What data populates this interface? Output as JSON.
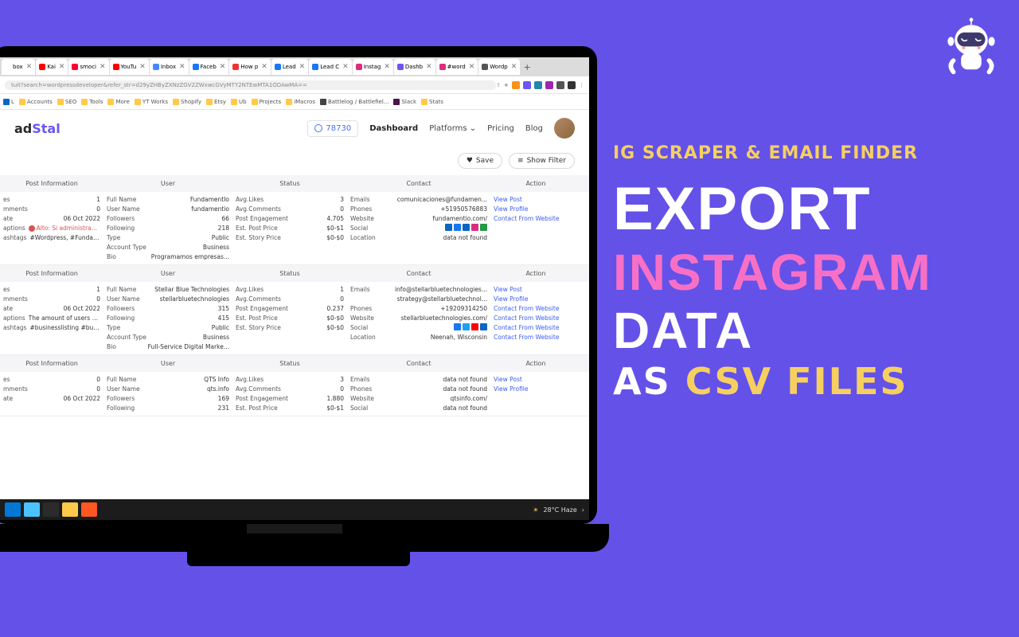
{
  "headline": {
    "sub": "IG SCRAPER & EMAIL FINDER",
    "l1": "EXPORT",
    "l2": "INSTAGRAM",
    "l3": "DATA",
    "l4a": "AS ",
    "l4b": "CSV FILES"
  },
  "tabs": [
    "box",
    "Kai",
    "smoci",
    "YouTu",
    "Inbox",
    "Faceb",
    "How p",
    "Lead",
    "Lead C",
    "Instag",
    "Dashb",
    "#word",
    "Wordp"
  ],
  "address": "tuit?search=wordpressdeveloper&refer_str=d29yZHByZXNzZGV2ZWxwcGVyMTY2NTEwMTA1ODAwMA==",
  "bookmarks": [
    "L",
    "Accounts",
    "SEO",
    "Tools",
    "More",
    "YT Works",
    "Shopify",
    "Etsy",
    "Ub",
    "Projects",
    "iMacros",
    "Battlelog / Battlefiel...",
    "Slack",
    "Stats"
  ],
  "logo": {
    "p1": "ad",
    "p2": "Stal"
  },
  "credits": "78730",
  "nav": {
    "dashboard": "Dashboard",
    "platforms": "Platforms",
    "pricing": "Pricing",
    "blog": "Blog"
  },
  "buttons": {
    "save": "Save",
    "filter": "Show Filter"
  },
  "columns": {
    "post": "Post Information",
    "user": "User",
    "status": "Status",
    "contact": "Contact",
    "action": "Action"
  },
  "rows": [
    {
      "post": [
        [
          "es",
          "1"
        ],
        [
          "mments",
          "0"
        ],
        [
          "ate",
          "06 Oct 2022"
        ],
        [
          "aptions",
          "Alto: Si administras o ..."
        ],
        [
          "ashtags",
          "#Wordpress, #Fundame..."
        ]
      ],
      "post_warn": 3,
      "user": [
        [
          "Full Name",
          "FundamentIo"
        ],
        [
          "User Name",
          "fundamentio"
        ],
        [
          "Followers",
          "66"
        ],
        [
          "Following",
          "218"
        ],
        [
          "Type",
          "Public"
        ],
        [
          "Account Type",
          "Business"
        ],
        [
          "Bio",
          "Programamos empresas..."
        ]
      ],
      "status": [
        [
          "Avg.Likes",
          "3"
        ],
        [
          "Avg.Comments",
          "0"
        ],
        [
          "Post Engagement",
          "4.705"
        ],
        [
          "Est. Post Price",
          "$0-$1"
        ],
        [
          "Est. Story Price",
          "$0-$0"
        ]
      ],
      "contact": [
        [
          "Emails",
          "comunicaciones@fundamen..."
        ],
        [
          "Phones",
          "+51950576883"
        ],
        [
          "Website",
          "fundamentio.com/"
        ],
        [
          "Social",
          "__social__"
        ],
        [
          "Location",
          "data not found"
        ]
      ],
      "social": [
        "#0a66c2",
        "#1877f2",
        "#0a66c2",
        "#d92e7f",
        "#229a46"
      ],
      "actions": [
        "View Post",
        "View Profile",
        "Contact From Website"
      ]
    },
    {
      "post": [
        [
          "es",
          "1"
        ],
        [
          "mments",
          "0"
        ],
        [
          "ate",
          "06 Oct 2022"
        ],
        [
          "aptions",
          "The amount of users sea..."
        ],
        [
          "ashtags",
          "#businesslisting #busin..."
        ]
      ],
      "user": [
        [
          "Full Name",
          "Stellar Blue Technologies"
        ],
        [
          "User Name",
          "stellarbluetechnologies"
        ],
        [
          "Followers",
          "315"
        ],
        [
          "Following",
          "415"
        ],
        [
          "Type",
          "Public"
        ],
        [
          "Account Type",
          "Business"
        ],
        [
          "Bio",
          "Full-Service Digital Marke..."
        ]
      ],
      "status": [
        [
          "Avg.Likes",
          "1"
        ],
        [
          "Avg.Comments",
          "0"
        ],
        [
          "Post Engagement",
          "0.237"
        ],
        [
          "Est. Post Price",
          "$0-$0"
        ],
        [
          "Est. Story Price",
          "$0-$0"
        ]
      ],
      "contact": [
        [
          "Emails",
          "info@stellarbluetechnologies..."
        ],
        [
          "",
          "strategy@stellarbluetechnol..."
        ],
        [
          "Phones",
          "+19209314250"
        ],
        [
          "Website",
          "stellarbluetechnologies.com/"
        ],
        [
          "Social",
          "__social__"
        ],
        [
          "Location",
          "Neenah, Wisconsin"
        ]
      ],
      "social": [
        "#1877f2",
        "#1da1f2",
        "#ff0000",
        "#0a66c2"
      ],
      "actions": [
        "View Post",
        "View Profile",
        "Contact From Website",
        "Contact From Website",
        "Contact From Website",
        "Contact From Website"
      ]
    },
    {
      "post": [
        [
          "es",
          "0"
        ],
        [
          "mments",
          "0"
        ],
        [
          "ate",
          "06 Oct 2022"
        ]
      ],
      "user": [
        [
          "Full Name",
          "QTS Info"
        ],
        [
          "User Name",
          "qts.info"
        ],
        [
          "Followers",
          "169"
        ],
        [
          "Following",
          "231"
        ]
      ],
      "status": [
        [
          "Avg.Likes",
          "3"
        ],
        [
          "Avg.Comments",
          "0"
        ],
        [
          "Post Engagement",
          "1.880"
        ],
        [
          "Est. Post Price",
          "$0-$1"
        ]
      ],
      "contact": [
        [
          "Emails",
          "data not found"
        ],
        [
          "Phones",
          "data not found"
        ],
        [
          "Website",
          "qtsinfo.com/"
        ],
        [
          "Social",
          "data not found"
        ]
      ],
      "actions": [
        "View Post",
        "View Profile"
      ]
    }
  ],
  "tabFavicons": [
    "#fff",
    "#f00",
    "#f03",
    "#f00",
    "#48f",
    "#1877f2",
    "#e33",
    "#1877f2",
    "#1877f2",
    "#d92e7f",
    "#6a56f3",
    "#d92e7f",
    "#555"
  ],
  "bmColors": [
    "#0a66c2",
    "#ffc94a",
    "#ffc94a",
    "#ffc94a",
    "#ffc94a",
    "#ffc94a",
    "#ffc94a",
    "#ffc94a",
    "#ffc94a",
    "#ffc94a",
    "#ffc94a",
    "#444",
    "#4a154b",
    "#ffc94a"
  ],
  "taskbar": {
    "icons": [
      "#0078d4",
      "#4cc2ff",
      "#2b2b2b",
      "#ffc94a",
      "#ff5722"
    ],
    "weather": "28°C Haze"
  }
}
